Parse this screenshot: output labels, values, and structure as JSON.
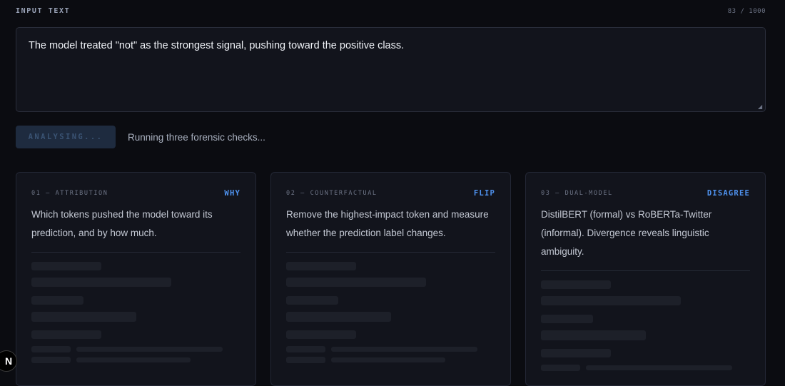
{
  "input": {
    "label": "INPUT TEXT",
    "char_count": "83 / 1000",
    "value": "The model treated \"not\" as the strongest signal, pushing toward the positive class."
  },
  "actions": {
    "analyse_label": "ANALYSING...",
    "status": "Running three forensic checks..."
  },
  "cards": [
    {
      "kicker": "01 — ATTRIBUTION",
      "tag": "WHY",
      "description": "Which tokens pushed the model toward its prediction, and by how much."
    },
    {
      "kicker": "02 — COUNTERFACTUAL",
      "tag": "FLIP",
      "description": "Remove the highest-impact token and measure whether the prediction label changes."
    },
    {
      "kicker": "03 — DUAL-MODEL",
      "tag": "DISAGREE",
      "description": "DistilBERT (formal) vs RoBERTa-Twitter (informal). Divergence reveals linguistic ambiguity."
    }
  ],
  "colors": {
    "accent": "#4f93f0",
    "background": "#0b0c11",
    "card": "#12141c"
  },
  "badge": {
    "letter": "N"
  }
}
